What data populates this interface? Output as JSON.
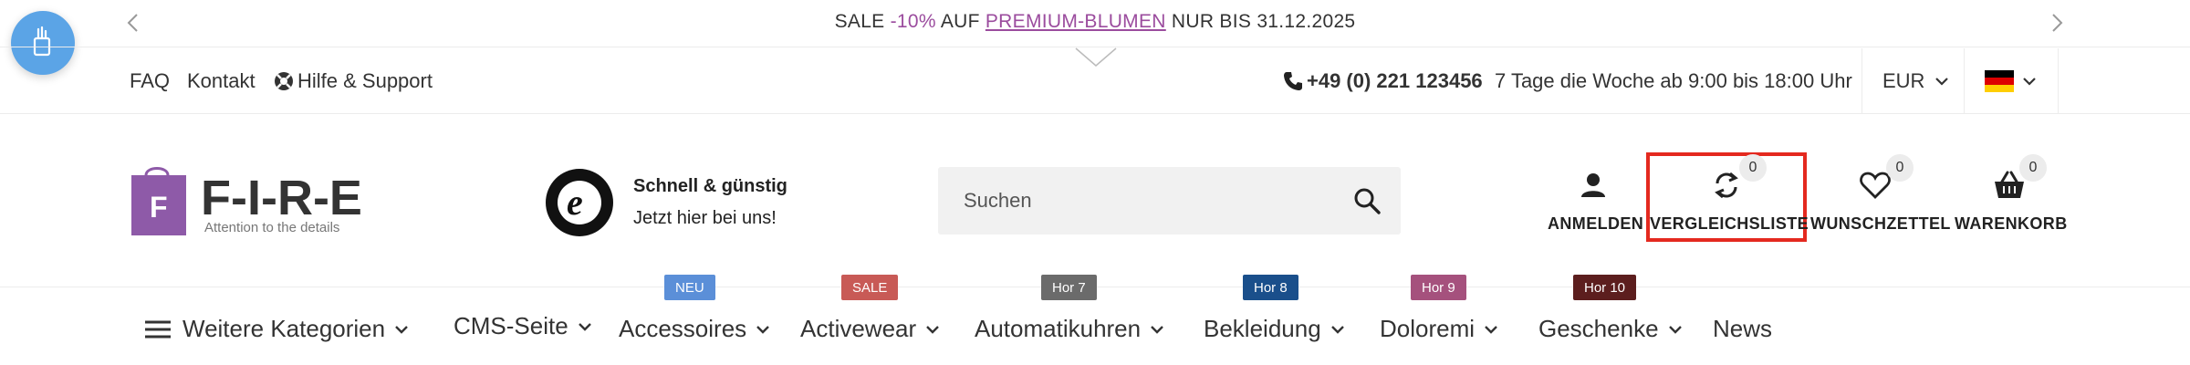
{
  "announcement": {
    "prefix": "SALE ",
    "discount": "-10%",
    "mid": " AUF ",
    "link": "PREMIUM-BLUMEN",
    "suffix": " NUR BIS 31.12.2025"
  },
  "service_links": {
    "faq": "FAQ",
    "contact": "Kontakt",
    "help": "Hilfe & Support"
  },
  "contact_info": {
    "phone": "+49 (0) 221 123456",
    "hours": "7 Tage die Woche ab 9:00 bis 18:00 Uhr"
  },
  "currency": {
    "selected": "EUR"
  },
  "language": {
    "selected_flag": "germany-flag-icon"
  },
  "logo": {
    "name": "F-I-R-E",
    "letter": "F",
    "tagline": "Attention to the details"
  },
  "trusted_shops": {
    "title": "Schnell & günstig",
    "subtitle": "Jetzt hier bei uns!"
  },
  "search": {
    "placeholder": "Suchen"
  },
  "header_actions": {
    "login": {
      "label": "ANMELDEN"
    },
    "compare": {
      "label": "VERGLEICHSLISTE",
      "count": "0"
    },
    "wishlist": {
      "label": "WUNSCHZETTEL",
      "count": "0"
    },
    "cart": {
      "label": "WARENKORB",
      "count": "0"
    }
  },
  "nav": {
    "categories_label": "Weitere Kategorien",
    "items": [
      {
        "label": "CMS-Seite",
        "tag": ""
      },
      {
        "label": "Accessoires",
        "tag": "NEU",
        "tag_color": "#5b8fd8"
      },
      {
        "label": "Activewear",
        "tag": "SALE",
        "tag_color": "#c85a56"
      },
      {
        "label": "Automatikuhren",
        "tag": "Hor 7",
        "tag_color": "#6b6b6b"
      },
      {
        "label": "Bekleidung",
        "tag": "Hor 8",
        "tag_color": "#1a4f8b"
      },
      {
        "label": "Doloremi",
        "tag": "Hor 9",
        "tag_color": "#a5517d"
      },
      {
        "label": "Geschenke",
        "tag": "Hor 10",
        "tag_color": "#5c1e1e"
      },
      {
        "label": "News",
        "tag": ""
      }
    ]
  },
  "colors": {
    "accent": "#9b4c9e",
    "highlight_border": "#e4291f",
    "float_button": "#5ba4e6"
  }
}
